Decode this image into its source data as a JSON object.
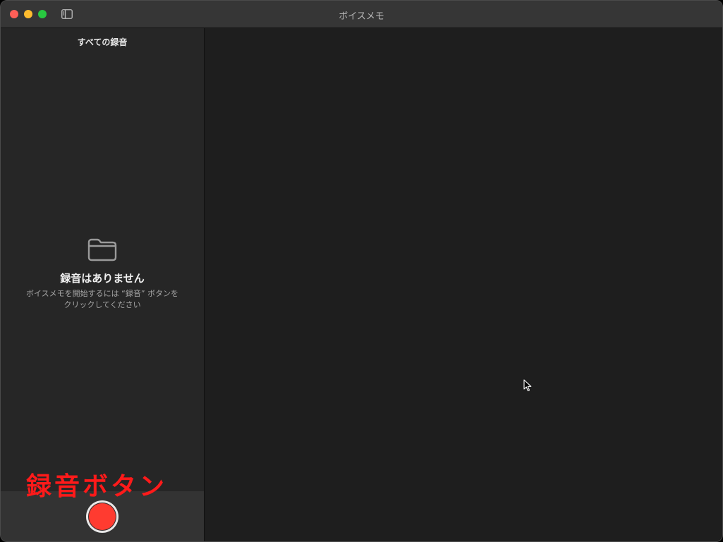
{
  "window": {
    "title": "ボイスメモ"
  },
  "sidebar": {
    "heading": "すべての録音",
    "empty_state": {
      "icon": "folder-icon",
      "title": "録音はありません",
      "description": "ボイスメモを開始するには “録音” ボタンをクリックしてください"
    }
  },
  "record_bar": {
    "button_color": "#ff3b30"
  },
  "annotation": {
    "text": "録音ボタン",
    "color": "#ff1a1a"
  }
}
